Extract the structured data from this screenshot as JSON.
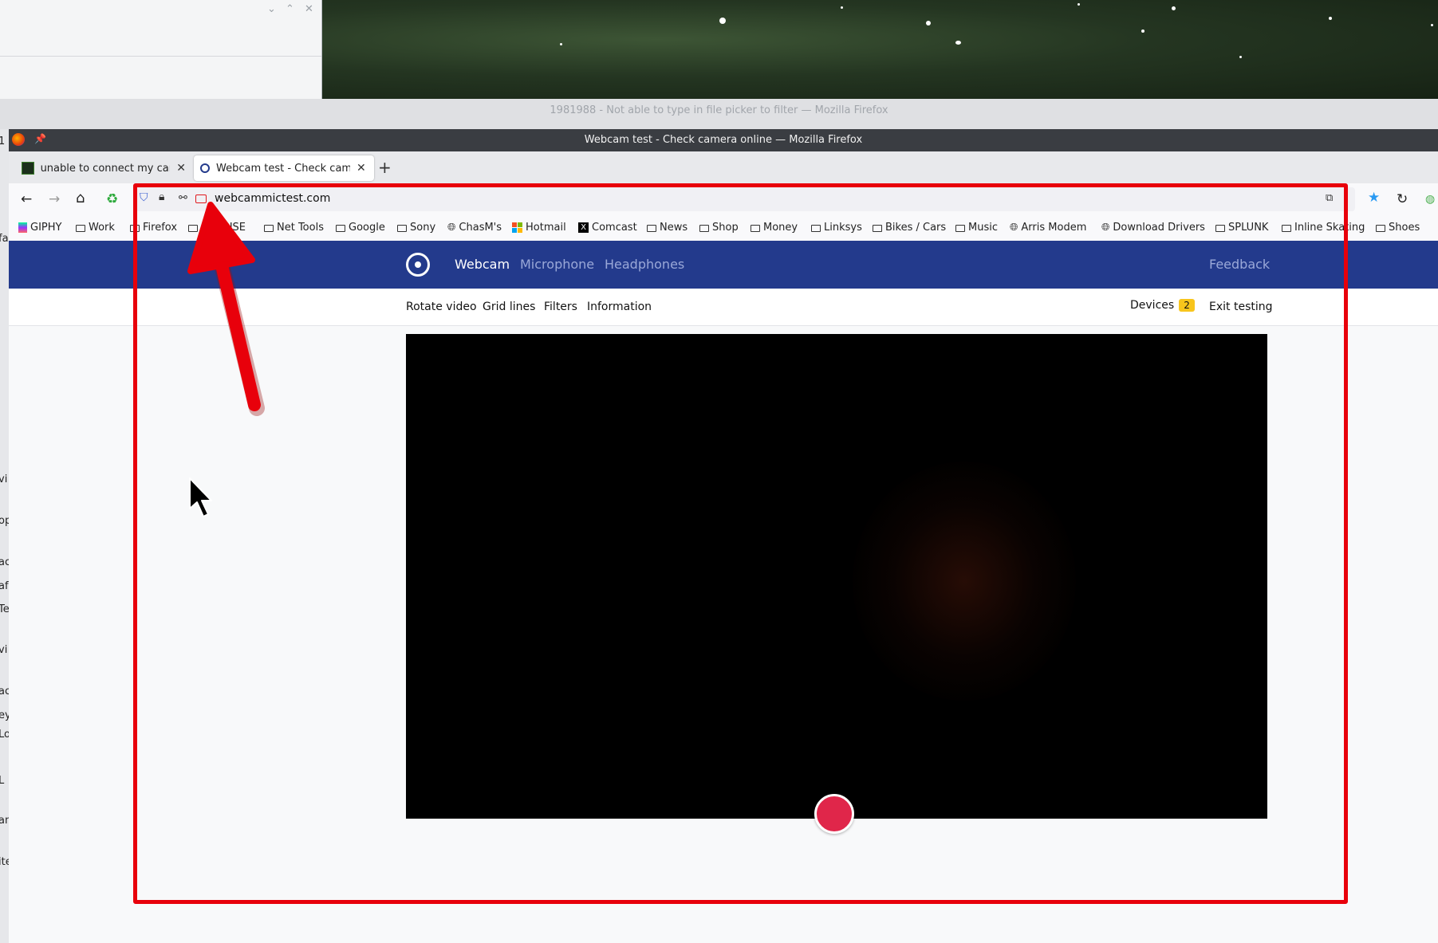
{
  "background": {
    "window_title": "1981988 - Not able to type in file picker to filter — Mozilla Firefox"
  },
  "firefox": {
    "window_title": "Webcam test - Check camera online — Mozilla Firefox",
    "tabs": [
      {
        "label": "unable to connect my cam",
        "active": false
      },
      {
        "label": "Webcam test - Check came",
        "active": true
      }
    ],
    "url": "webcammictest.com",
    "bookmarks": [
      {
        "label": "GIPHY",
        "icon": "giphy-icon"
      },
      {
        "label": "Work",
        "icon": "folder-icon"
      },
      {
        "label": "Firefox",
        "icon": "folder-icon"
      },
      {
        "label": "USE",
        "icon": "folder-icon"
      },
      {
        "label": "Net Tools",
        "icon": "folder-icon"
      },
      {
        "label": "Google",
        "icon": "folder-icon"
      },
      {
        "label": "Sony",
        "icon": "folder-icon"
      },
      {
        "label": "ChasM's",
        "icon": "globe-icon"
      },
      {
        "label": "Hotmail",
        "icon": "microsoft-icon"
      },
      {
        "label": "Comcast",
        "icon": "x-icon"
      },
      {
        "label": "News",
        "icon": "folder-icon"
      },
      {
        "label": "Shop",
        "icon": "folder-icon"
      },
      {
        "label": "Money",
        "icon": "folder-icon"
      },
      {
        "label": "Linksys",
        "icon": "folder-icon"
      },
      {
        "label": "Bikes / Cars",
        "icon": "folder-icon"
      },
      {
        "label": "Music",
        "icon": "folder-icon"
      },
      {
        "label": "Arris Modem",
        "icon": "globe-icon"
      },
      {
        "label": "Download Drivers",
        "icon": "globe-icon"
      },
      {
        "label": "SPLUNK",
        "icon": "folder-icon"
      },
      {
        "label": "Inline Skating",
        "icon": "folder-icon"
      },
      {
        "label": "Shoes",
        "icon": "folder-icon"
      }
    ]
  },
  "site": {
    "nav": {
      "webcam": "Webcam",
      "microphone": "Microphone",
      "headphones": "Headphones",
      "feedback": "Feedback"
    },
    "subnav": {
      "rotate": "Rotate video",
      "grid": "Grid lines",
      "filters": "Filters",
      "information": "Information",
      "devices": "Devices",
      "devices_count": "2",
      "exit": "Exit testing"
    }
  },
  "colors": {
    "site_nav_bg": "#233a8c",
    "record_button": "#e0264a",
    "annotation_red": "#e8000b",
    "badge": "#f8c51c"
  }
}
